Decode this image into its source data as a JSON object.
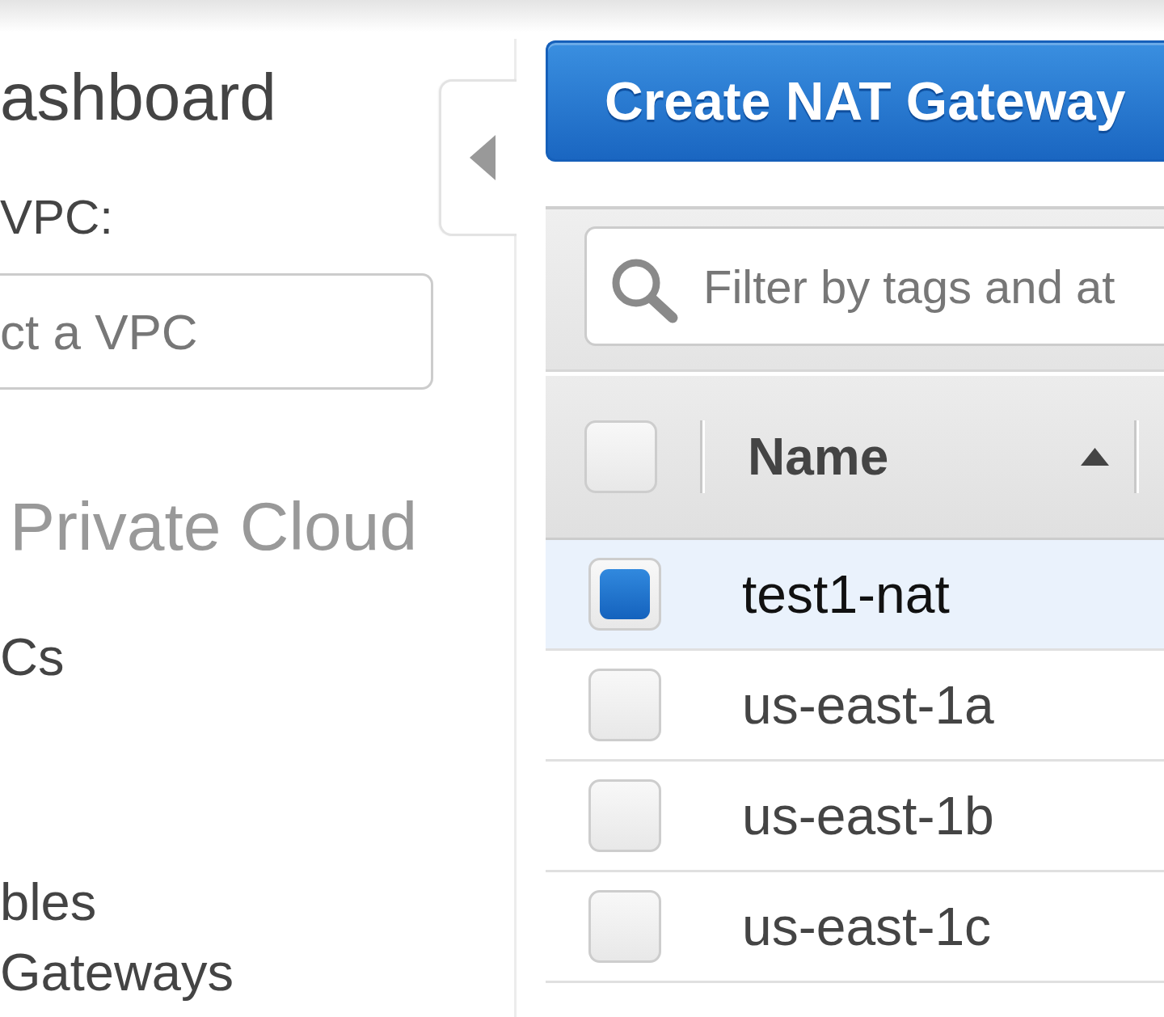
{
  "sidebar": {
    "title": "ashboard",
    "filter_label": "VPC:",
    "vpc_select": {
      "placeholder": "ct a VPC"
    },
    "section_heading": "Private Cloud",
    "items": [
      {
        "label": "Cs"
      },
      {
        "label": "bles"
      },
      {
        "label": "Gateways"
      }
    ]
  },
  "create_button": {
    "label": "Create NAT Gateway"
  },
  "filter": {
    "placeholder": "Filter by tags and at"
  },
  "table": {
    "select_all": {
      "checked": false
    },
    "columns": [
      {
        "label": "Name",
        "ascending": true
      }
    ],
    "rows": [
      {
        "name": "test1-nat",
        "selected": true
      },
      {
        "name": "us-east-1a",
        "selected": false
      },
      {
        "name": "us-east-1b",
        "selected": false
      },
      {
        "name": "us-east-1c",
        "selected": false
      }
    ]
  }
}
